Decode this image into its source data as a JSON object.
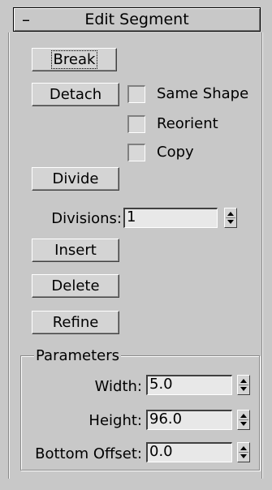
{
  "rollout": {
    "title": "Edit Segment",
    "collapse_symbol": "–"
  },
  "buttons": {
    "break": "Break",
    "detach": "Detach",
    "divide": "Divide",
    "insert": "Insert",
    "delete": "Delete",
    "refine": "Refine"
  },
  "checkboxes": {
    "same_shape": {
      "label": "Same Shape",
      "checked": false
    },
    "reorient": {
      "label": "Reorient",
      "checked": false
    },
    "copy": {
      "label": "Copy",
      "checked": false
    }
  },
  "divisions": {
    "label": "Divisions:",
    "value": "1"
  },
  "parameters": {
    "title": "Parameters",
    "width": {
      "label": "Width:",
      "value": "5.0"
    },
    "height": {
      "label": "Height:",
      "value": "96.0"
    },
    "bottom_offset": {
      "label": "Bottom Offset:",
      "value": "0.0"
    }
  }
}
